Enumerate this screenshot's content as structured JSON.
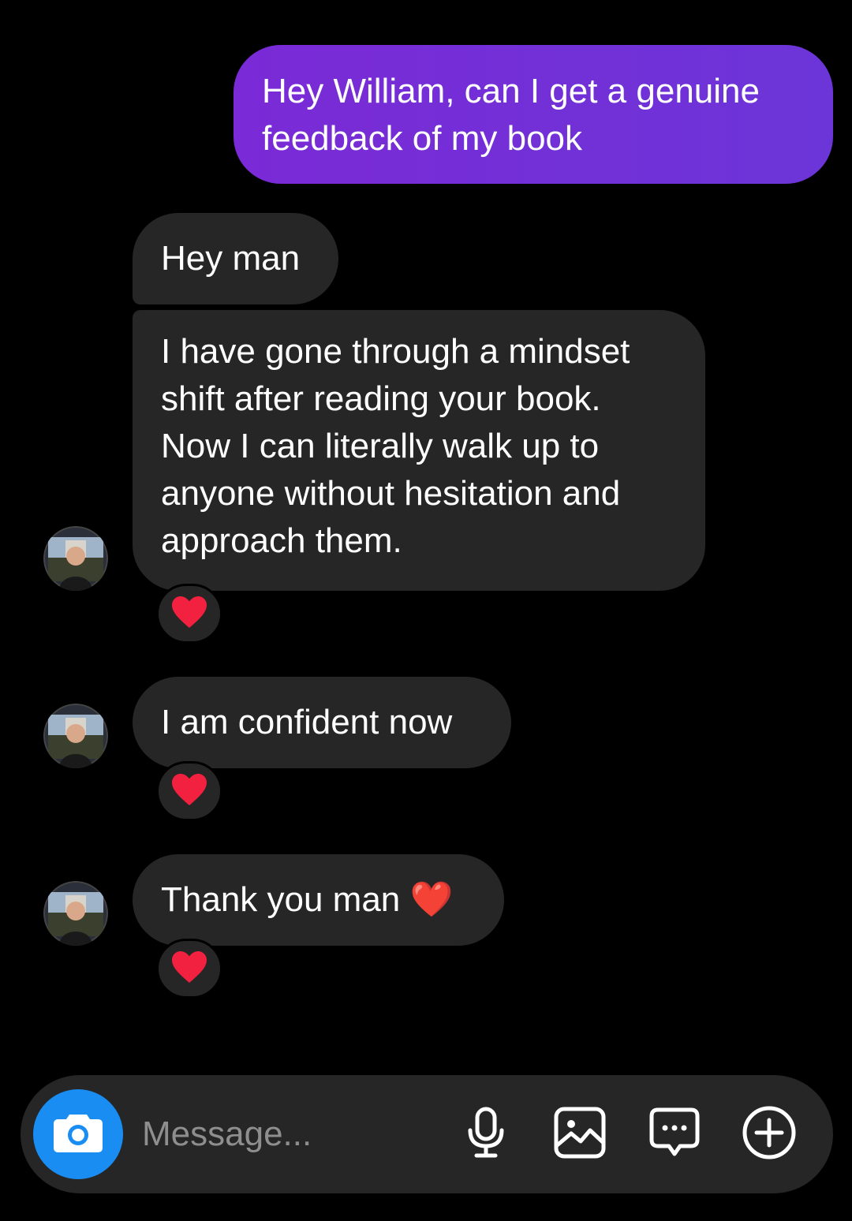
{
  "thread": {
    "outgoing": [
      {
        "text": "Hey William, can I get a genuine feedback of my book"
      }
    ],
    "incoming": [
      {
        "text": "Hey man"
      },
      {
        "text": "I have gone through a mindset shift after reading your book. Now I can literally walk up to anyone without hesitation and approach them."
      },
      {
        "text": "I am confident now"
      },
      {
        "text": "Thank you man ❤️"
      }
    ],
    "reactions": [
      "❤️",
      "❤️",
      "❤️"
    ]
  },
  "composer": {
    "placeholder": "Message...",
    "icons": [
      "camera-icon",
      "microphone-icon",
      "gallery-icon",
      "sticker-icon",
      "plus-icon"
    ]
  },
  "colors": {
    "background": "#000000",
    "incoming_bubble": "#262626",
    "outgoing_bubble_start": "#7a2ad6",
    "outgoing_bubble_end": "#6c35d8",
    "camera_button": "#1a8df2",
    "placeholder": "#8e8e8e"
  }
}
